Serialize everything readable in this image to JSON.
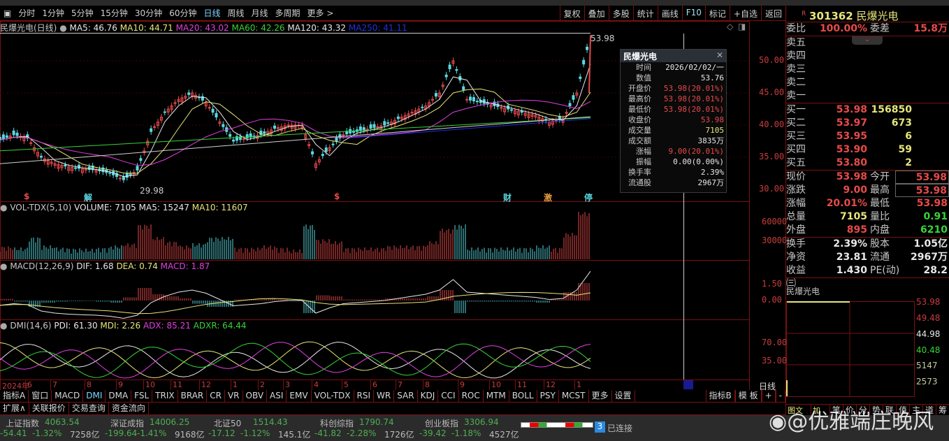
{
  "toolbar": {
    "periods": [
      "分时",
      "1分钟",
      "5分钟",
      "15分钟",
      "30分钟",
      "60分钟",
      "日线",
      "周线",
      "月线",
      "多周期",
      "更多 >"
    ],
    "active": "日线",
    "actions": [
      "复权",
      "叠加",
      "多股",
      "统计",
      "画线",
      "F10",
      "标记",
      "+自选",
      "返回"
    ]
  },
  "stock": {
    "code": "301362",
    "name": "民爆光电",
    "badge": "R"
  },
  "main_legend": {
    "title": "民爆光电(日线)",
    "ma5": "MA5: 46.76",
    "ma10": "MA10: 44.71",
    "ma20": "MA20: 43.02",
    "ma60": "MA60: 42.26",
    "ma120": "MA120: 43.32",
    "ma250": "MA250: 41.11"
  },
  "colors": {
    "ma5": "#e8e8e8",
    "ma10": "#e6e67a",
    "ma20": "#e040e0",
    "ma60": "#37d437",
    "ma120": "#d0d0d0",
    "ma250": "#2030e0",
    "up": "#e84a4a",
    "down": "#5ad8e0",
    "grid": "#7a1010"
  },
  "price_axis": [
    "50.00",
    "45.00",
    "40.00",
    "35.00",
    "30.00"
  ],
  "price_marks": {
    "high": "53.98",
    "low": "29.98"
  },
  "event_marks": [
    "$",
    "解",
    "$",
    "财",
    "激",
    "停"
  ],
  "chart_data": {
    "type": "candlestick",
    "ylim": [
      29,
      54
    ],
    "closes": [
      37.7,
      38.5,
      38,
      35,
      34,
      33.5,
      33.2,
      33,
      32.5,
      31.5,
      33,
      39,
      42,
      44,
      45,
      43.5,
      40.5,
      37.5,
      38,
      38.5,
      39.5,
      40,
      40,
      34,
      36.5,
      38.5,
      39,
      39.5,
      40,
      41,
      42,
      43,
      45,
      50,
      44,
      43.5,
      43,
      42.5,
      42,
      41.5,
      40.5,
      41,
      45,
      53.98
    ]
  },
  "popup": {
    "title": "民爆光电",
    "rows": [
      [
        "时间",
        "2026/02/02/一",
        "wht"
      ],
      [
        "数值",
        "53.76",
        "wht"
      ],
      [
        "开盘价",
        "53.98(20.01%)",
        "red"
      ],
      [
        "最高价",
        "53.98(20.01%)",
        "red"
      ],
      [
        "最低价",
        "53.98(20.01%)",
        "red"
      ],
      [
        "收盘价",
        "53.98",
        "red"
      ],
      [
        "成交量",
        "7105",
        "yel"
      ],
      [
        "成交额",
        "3835万",
        "wht"
      ],
      [
        "涨幅",
        "9.00(20.01%)",
        "red"
      ],
      [
        "振幅",
        "0.00(0.00%)",
        "wht"
      ],
      [
        "换手率",
        "2.39%",
        "wht"
      ],
      [
        "流通股",
        "2967万",
        "wht"
      ]
    ]
  },
  "vol": {
    "legend": "VOL-TDX(5,10)",
    "volume": "VOLUME: 7105",
    "ma5": "MA5: 15247",
    "ma10": "MA10: 11607",
    "axis": [
      "60000",
      "30000"
    ]
  },
  "macd": {
    "legend": "MACD(12,26,9)",
    "dif": "DIF: 1.68",
    "dea": "DEA: 0.74",
    "macd": "MACD: 1.87",
    "axis": [
      "1.50",
      "0.00"
    ]
  },
  "dmi": {
    "legend": "DMI(14,6)",
    "pdi": "PDI: 61.30",
    "mdi": "MDI: 2.26",
    "adx": "ADX: 85.21",
    "adxr": "ADXR: 64.44",
    "axis": [
      "70.00",
      "35.00"
    ]
  },
  "date_axis": [
    "2024年",
    "6",
    "7",
    "8",
    "9",
    "10",
    "11",
    "12",
    "1",
    "2",
    "3",
    "4",
    "5",
    "6",
    "7",
    "8",
    "9",
    "10",
    "11",
    "12",
    "1"
  ],
  "date_axis_right": "日线",
  "indicator_tabs": [
    "指标A",
    "窗口",
    "MACD",
    "DMI",
    "DMA",
    "FSL",
    "TRIX",
    "BRAR",
    "CR",
    "VR",
    "OBV",
    "ASI",
    "EMV",
    "VOL-TDX",
    "RSI",
    "WR",
    "SAR",
    "KDJ",
    "CCI",
    "ROC",
    "MTM",
    "BOLL",
    "PSY",
    "MCST",
    "更多",
    "设置"
  ],
  "indicator_active": "DMI",
  "indicator_right": [
    "指标B",
    "模 板",
    "+",
    "-"
  ],
  "sub_tabs": [
    "扩展∧",
    "关联报价",
    "交易查询",
    "资金流向"
  ],
  "right_tabs": [
    "图文F10",
    "加栏∧",
    "笔",
    "价",
    "分",
    "势",
    "联",
    "值",
    "主",
    "道",
    "筹"
  ],
  "quote": {
    "weibi": [
      "委比",
      "100.00%",
      "委差",
      "15.8万"
    ],
    "sell": [
      "卖五",
      "卖四",
      "卖三",
      "卖二",
      "卖一"
    ],
    "buy": [
      [
        "买一",
        "53.98",
        "156850"
      ],
      [
        "买二",
        "53.97",
        "673"
      ],
      [
        "买三",
        "53.95",
        "6"
      ],
      [
        "买四",
        "53.90",
        "59"
      ],
      [
        "买五",
        "53.80",
        "2"
      ]
    ],
    "stats": [
      [
        "现价",
        "53.98",
        "red",
        "今开",
        "53.98",
        "red"
      ],
      [
        "涨跌",
        "9.00",
        "red",
        "最高",
        "53.98",
        "red"
      ],
      [
        "涨幅",
        "20.01%",
        "red",
        "最低",
        "53.98",
        "red"
      ],
      [
        "总量",
        "7105",
        "yel",
        "量比",
        "0.91",
        "grn"
      ],
      [
        "外盘",
        "895",
        "red",
        "内盘",
        "6210",
        "grn"
      ]
    ],
    "fund": [
      [
        "换手",
        "2.39%",
        "股本",
        "1.05亿"
      ],
      [
        "净资",
        "23.81",
        "流通",
        "2967万"
      ],
      [
        "收益㈢",
        "1.430",
        "PE(动)",
        "28.2"
      ]
    ]
  },
  "mini": {
    "title": "民爆光电",
    "axis": [
      "53.98",
      "49.48",
      "44.98",
      "40.48",
      "5147",
      "2573"
    ]
  },
  "indices": [
    {
      "name": "上证指数",
      "value": "4063.54",
      "chg": "-54.41",
      "pct": "-1.32%",
      "amt": "7258亿"
    },
    {
      "name": "深证成指",
      "value": "14006.25",
      "chg": "-199.64",
      "pct": "-1.41%",
      "amt": "9168亿"
    },
    {
      "name": "北证50",
      "value": "1514.43",
      "chg": "-17.12",
      "pct": "-1.12%",
      "amt": "145.1亿"
    },
    {
      "name": "科创综指",
      "value": "1790.74",
      "chg": "-41.82",
      "pct": "-2.28%",
      "amt": "1726亿"
    },
    {
      "name": "创业板指",
      "value": "3306.94",
      "chg": "-39.42",
      "pct": "-1.18%",
      "amt": "4527亿"
    }
  ],
  "connection": {
    "count": "3",
    "label": "已连接"
  },
  "watermark": "@优雅端庄晚风"
}
